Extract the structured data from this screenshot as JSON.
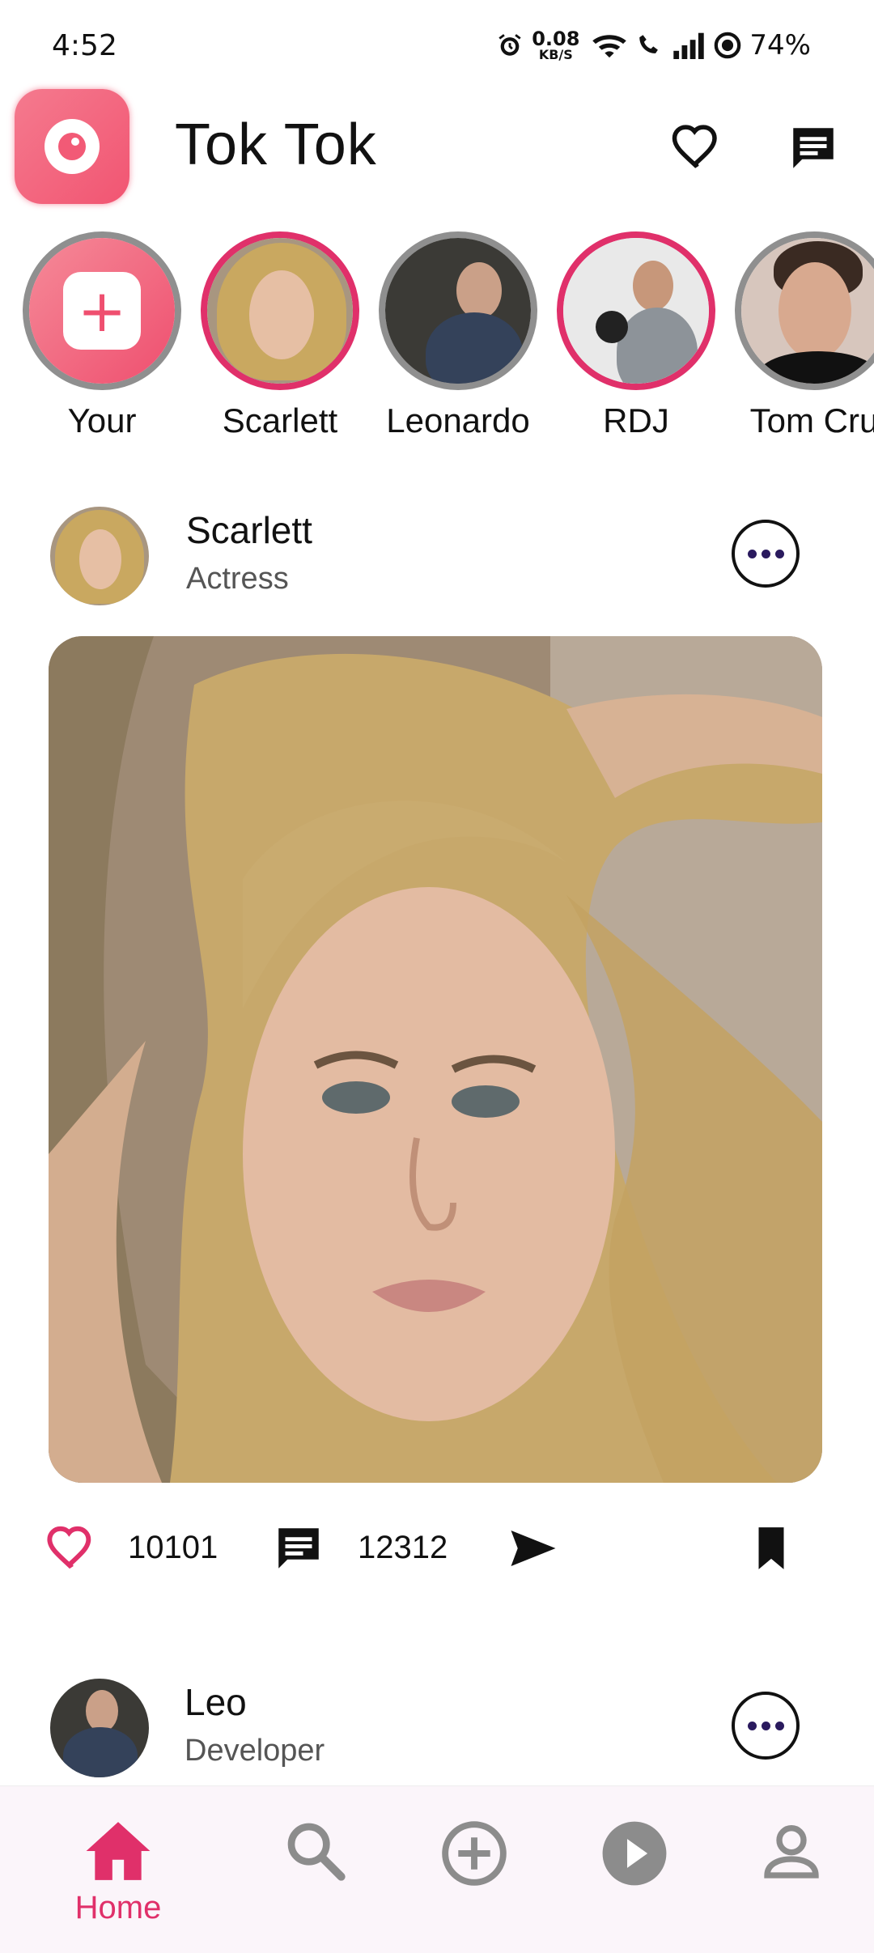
{
  "status": {
    "time": "4:52",
    "net_speed_value": "0.08",
    "net_speed_unit": "KB/S",
    "battery": "74%"
  },
  "appbar": {
    "title": "Tok Tok",
    "icons": [
      "heart-outline-icon",
      "chat-icon"
    ]
  },
  "stories": [
    {
      "label": "Your"
    },
    {
      "label": "Scarlett"
    },
    {
      "label": "Leonardo"
    },
    {
      "label": "RDJ"
    },
    {
      "label": "Tom Cru"
    }
  ],
  "post": {
    "author": "Scarlett",
    "role": "Actress",
    "likes": "10101",
    "comments": "12312"
  },
  "next_post": {
    "author": "Leo",
    "role": "Developer"
  },
  "bottom_nav": {
    "home_label": "Home",
    "items": [
      "home-icon",
      "search-icon",
      "add-circle-icon",
      "play-circle-icon",
      "profile-icon"
    ]
  },
  "colors": {
    "accent": "#e0306a",
    "logo": "#f25572",
    "nav_background": "#fbf5fa"
  }
}
